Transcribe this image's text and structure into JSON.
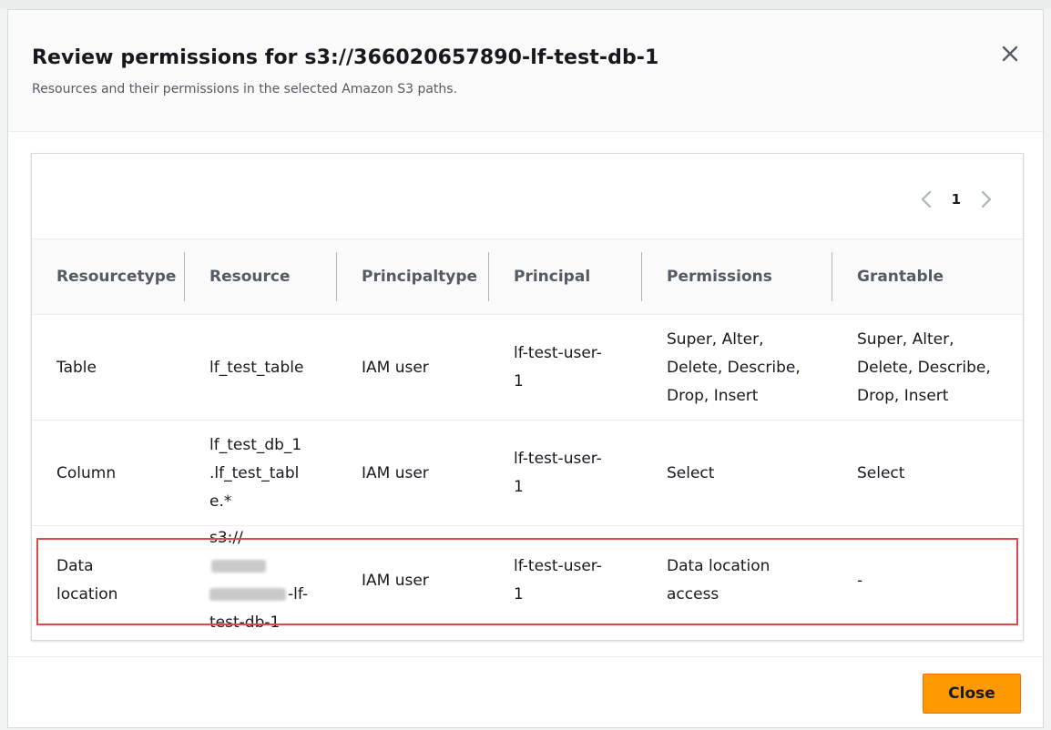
{
  "modal": {
    "title": "Review permissions for s3://366020657890-lf-test-db-1",
    "subtitle": "Resources and their permissions in the selected Amazon S3 paths.",
    "close_icon": "close-icon"
  },
  "pagination": {
    "current_page": "1",
    "prev_icon": "chevron-left-icon",
    "next_icon": "chevron-right-icon"
  },
  "table": {
    "headers": [
      "Resource type",
      "Resource",
      "Principal type",
      "Principal",
      "Permissions",
      "Grantable"
    ],
    "header_lines": [
      [
        "Resource",
        "type"
      ],
      [
        "Resource"
      ],
      [
        "Principal",
        "type"
      ],
      [
        "Principal"
      ],
      [
        "Permissions"
      ],
      [
        "Grantable"
      ]
    ],
    "rows": [
      {
        "resource_type": [
          "Table"
        ],
        "resource": [
          "lf_test_table"
        ],
        "principal_type": [
          "IAM user"
        ],
        "principal": [
          "lf-test-user-",
          "1"
        ],
        "permissions": [
          "Super, Alter,",
          "Delete, Describe,",
          "Drop, Insert"
        ],
        "grantable": [
          "Super, Alter,",
          "Delete, Describe,",
          "Drop, Insert"
        ]
      },
      {
        "resource_type": [
          "Column"
        ],
        "resource": [
          "lf_test_db_1",
          ".lf_test_tabl",
          "e.*"
        ],
        "principal_type": [
          "IAM user"
        ],
        "principal": [
          "lf-test-user-",
          "1"
        ],
        "permissions": [
          "Select"
        ],
        "grantable": [
          "Select"
        ]
      },
      {
        "resource_type": [
          "Data",
          "location"
        ],
        "resource_prefix": "s3://",
        "resource_mid_suffix": "-lf-",
        "resource_last": "test-db-1",
        "principal_type": [
          "IAM user"
        ],
        "principal": [
          "lf-test-user-",
          "1"
        ],
        "permissions": [
          "Data location",
          "access"
        ],
        "grantable": [
          "-"
        ]
      }
    ]
  },
  "footer": {
    "close_label": "Close"
  },
  "colors": {
    "primary_button": "#ff9900",
    "highlight_border": "#e0474c"
  }
}
